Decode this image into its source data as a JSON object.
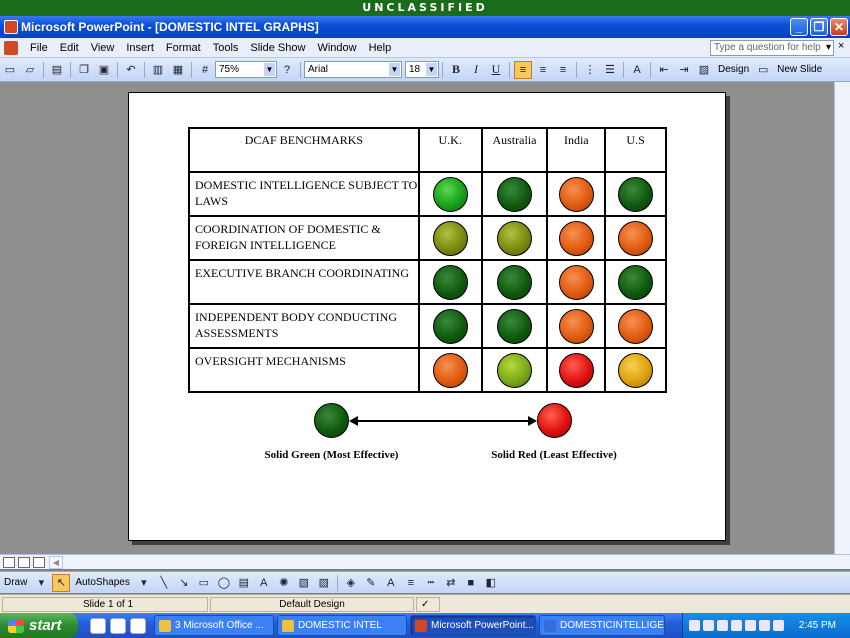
{
  "banner": "UNCLASSIFIED",
  "window": {
    "title": "Microsoft PowerPoint - [DOMESTIC INTEL GRAPHS]",
    "minimize": "_",
    "restore": "❐",
    "close": "✕"
  },
  "menu": {
    "items": [
      "File",
      "Edit",
      "View",
      "Insert",
      "Format",
      "Tools",
      "Slide Show",
      "Window",
      "Help"
    ],
    "help_placeholder": "Type a question for help",
    "close": "×"
  },
  "toolbar": {
    "zoom": "75%",
    "font": "Arial",
    "font_size": "18",
    "bold": "B",
    "italic": "I",
    "underline": "U",
    "design_label": "Design",
    "new_slide_label": "New Slide"
  },
  "slide": {
    "table": {
      "headers": [
        "DCAF BENCHMARKS",
        "U.K.",
        "Australia",
        "India",
        "U.S"
      ],
      "rows": [
        {
          "label": "DOMESTIC INTELLIGENCE SUBJECT TO LAWS",
          "ratings": [
            "bright-green",
            "green",
            "orange",
            "green"
          ]
        },
        {
          "label": "COORDINATION OF DOMESTIC & FOREIGN INTELLIGENCE",
          "ratings": [
            "olive",
            "olive",
            "orange",
            "orange"
          ]
        },
        {
          "label": "EXECUTIVE BRANCH COORDINATING",
          "ratings": [
            "green",
            "green",
            "orange",
            "green"
          ]
        },
        {
          "label": "INDEPENDENT BODY CONDUCTING ASSESSMENTS",
          "ratings": [
            "green",
            "green",
            "orange",
            "orange"
          ]
        },
        {
          "label": "OVERSIGHT MECHANISMS",
          "ratings": [
            "orange",
            "lime",
            "red",
            "yellow"
          ]
        }
      ]
    },
    "legend": {
      "green_label": "Solid Green (Most Effective)",
      "red_label": "Solid Red (Least Effective)"
    }
  },
  "drawbar": {
    "draw_label": "Draw",
    "autoshapes_label": "AutoShapes"
  },
  "status": {
    "slide_info": "Slide 1 of 1",
    "design": "Default Design"
  },
  "taskbar": {
    "start_label": "start",
    "tasks": [
      "3 Microsoft Office ...",
      "DOMESTIC INTEL",
      "Microsoft PowerPoint...",
      "DOMESTICINTELLIGE..."
    ],
    "clock": "2:45 PM"
  },
  "colors": {
    "banner": "#1a6b1a",
    "bright-green": "#19a019",
    "green": "#0f5a0f",
    "olive": "#7a8a10",
    "lime": "#7aa818",
    "orange": "#e05a10",
    "red": "#e01010",
    "yellow": "#e0a010"
  }
}
